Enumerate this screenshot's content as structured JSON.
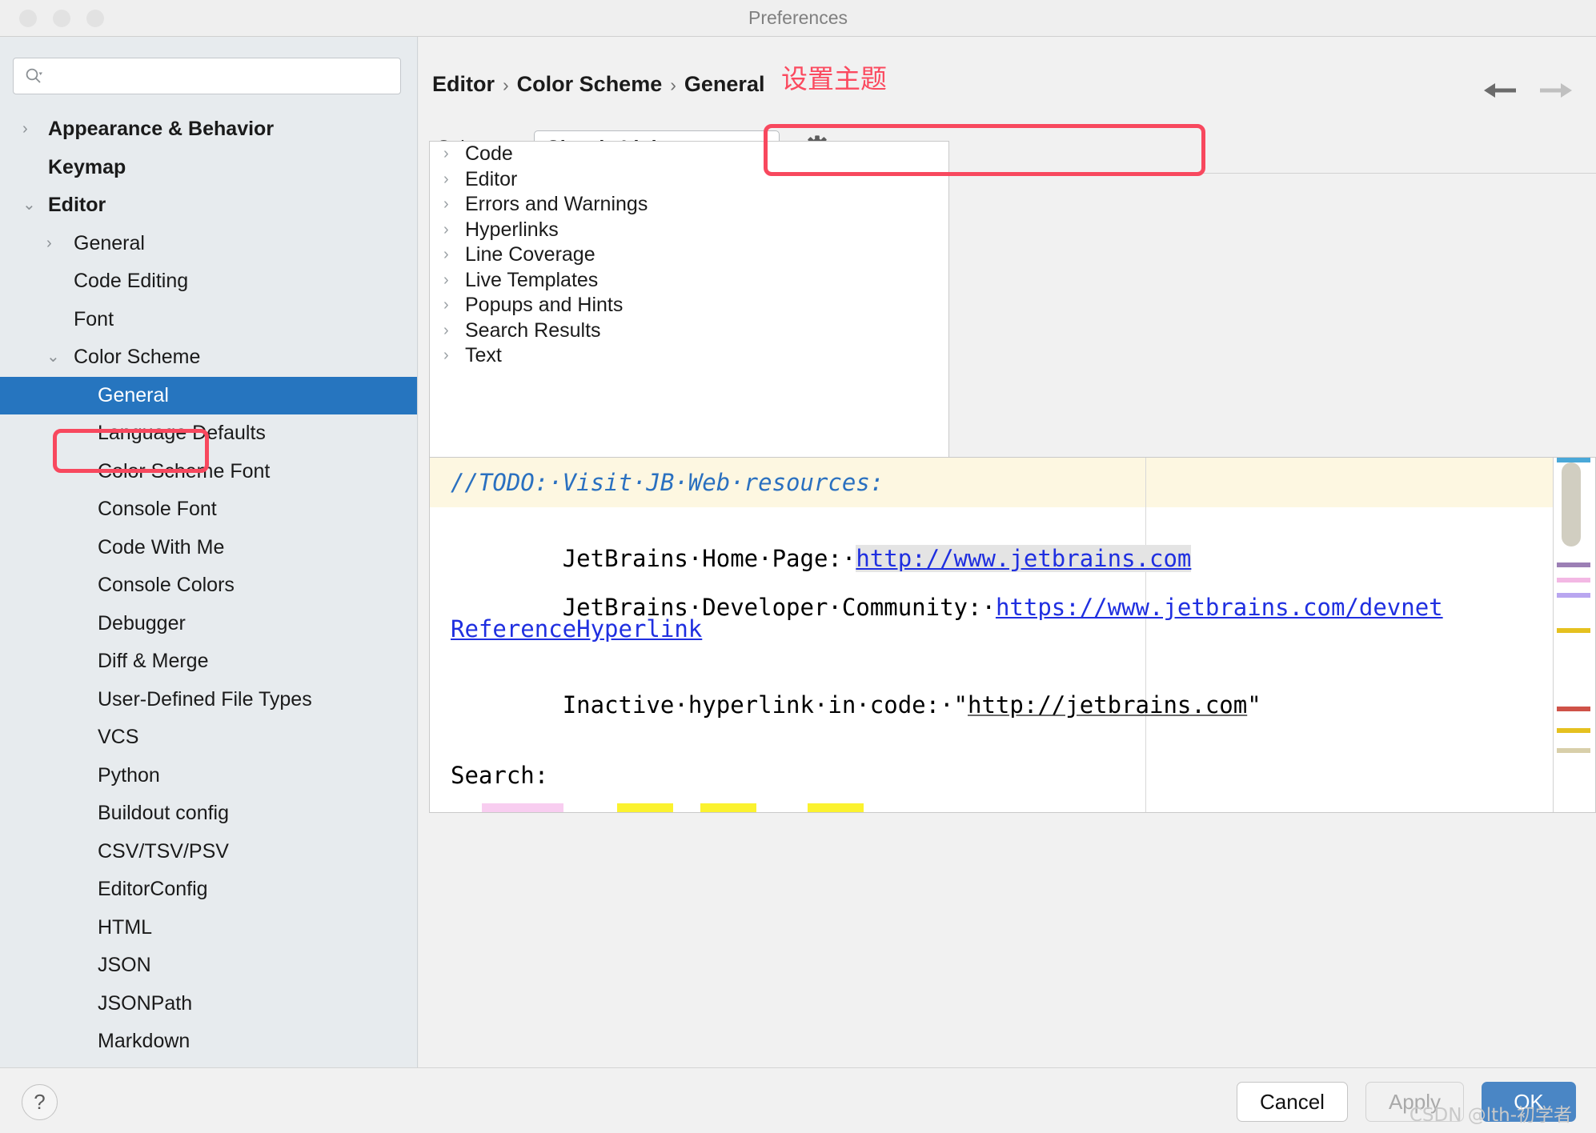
{
  "window": {
    "title": "Preferences"
  },
  "sidebar": {
    "search_placeholder": "",
    "search_value": "",
    "items": [
      {
        "label": "Appearance & Behavior",
        "level": 0,
        "arrow": "›",
        "selected": false
      },
      {
        "label": "Keymap",
        "level": 0,
        "arrow": "",
        "selected": false
      },
      {
        "label": "Editor",
        "level": 0,
        "arrow": "⌄",
        "selected": false
      },
      {
        "label": "General",
        "level": 1,
        "arrow": "›",
        "selected": false
      },
      {
        "label": "Code Editing",
        "level": 1,
        "arrow": "",
        "selected": false
      },
      {
        "label": "Font",
        "level": 1,
        "arrow": "",
        "selected": false
      },
      {
        "label": "Color Scheme",
        "level": 1,
        "arrow": "⌄",
        "selected": false
      },
      {
        "label": "General",
        "level": 2,
        "arrow": "",
        "selected": true
      },
      {
        "label": "Language Defaults",
        "level": 2,
        "arrow": "",
        "selected": false
      },
      {
        "label": "Color Scheme Font",
        "level": 2,
        "arrow": "",
        "selected": false
      },
      {
        "label": "Console Font",
        "level": 2,
        "arrow": "",
        "selected": false
      },
      {
        "label": "Code With Me",
        "level": 2,
        "arrow": "",
        "selected": false
      },
      {
        "label": "Console Colors",
        "level": 2,
        "arrow": "",
        "selected": false
      },
      {
        "label": "Debugger",
        "level": 2,
        "arrow": "",
        "selected": false
      },
      {
        "label": "Diff & Merge",
        "level": 2,
        "arrow": "",
        "selected": false
      },
      {
        "label": "User-Defined File Types",
        "level": 2,
        "arrow": "",
        "selected": false
      },
      {
        "label": "VCS",
        "level": 2,
        "arrow": "",
        "selected": false
      },
      {
        "label": "Python",
        "level": 2,
        "arrow": "",
        "selected": false
      },
      {
        "label": "Buildout config",
        "level": 2,
        "arrow": "",
        "selected": false
      },
      {
        "label": "CSV/TSV/PSV",
        "level": 2,
        "arrow": "",
        "selected": false
      },
      {
        "label": "EditorConfig",
        "level": 2,
        "arrow": "",
        "selected": false
      },
      {
        "label": "HTML",
        "level": 2,
        "arrow": "",
        "selected": false
      },
      {
        "label": "JSON",
        "level": 2,
        "arrow": "",
        "selected": false
      },
      {
        "label": "JSONPath",
        "level": 2,
        "arrow": "",
        "selected": false
      },
      {
        "label": "Markdown",
        "level": 2,
        "arrow": "",
        "selected": false
      }
    ]
  },
  "main": {
    "breadcrumb": [
      "Editor",
      "Color Scheme",
      "General"
    ],
    "breadcrumb_separator": "›",
    "annotation": "设置主题",
    "scheme": {
      "label": "Scheme:",
      "value": "Classic Light",
      "gear_tooltip": "Show Scheme Actions"
    },
    "settings_tree": [
      {
        "label": "Code",
        "arrow": "›"
      },
      {
        "label": "Editor",
        "arrow": "›"
      },
      {
        "label": "Errors and Warnings",
        "arrow": "›"
      },
      {
        "label": "Hyperlinks",
        "arrow": "›"
      },
      {
        "label": "Line Coverage",
        "arrow": "›"
      },
      {
        "label": "Live Templates",
        "arrow": "›"
      },
      {
        "label": "Popups and Hints",
        "arrow": "›"
      },
      {
        "label": "Search Results",
        "arrow": "›"
      },
      {
        "label": "Text",
        "arrow": "›"
      }
    ],
    "preview": {
      "todo_line": "//TODO:·Visit·JB·Web·resources:",
      "home_label": "JetBrains·Home·Page:·",
      "home_url": "http://www.jetbrains.com",
      "devnet_label": "JetBrains·Developer·Community:·",
      "devnet_url": "https://www.jetbrains.com/devnet",
      "reference_link": "ReferenceHyperlink",
      "inactive_prefix": "Inactive·hyperlink·in·code:·\"",
      "inactive_url": "http://jetbrains.com",
      "inactive_suffix": "\"",
      "search_label": "Search:"
    }
  },
  "footer": {
    "help_label": "?",
    "cancel_label": "Cancel",
    "apply_label": "Apply",
    "ok_label": "OK",
    "watermark": "CSDN @lth-初学者"
  },
  "colors": {
    "accent_selection": "#2675bf",
    "annotation_red": "#fb4a5f",
    "ok_button": "#4a86c5",
    "todo_band": "#fdf7e1",
    "link_blue": "#1f2fe0",
    "comment_blue": "#2a70c0"
  }
}
